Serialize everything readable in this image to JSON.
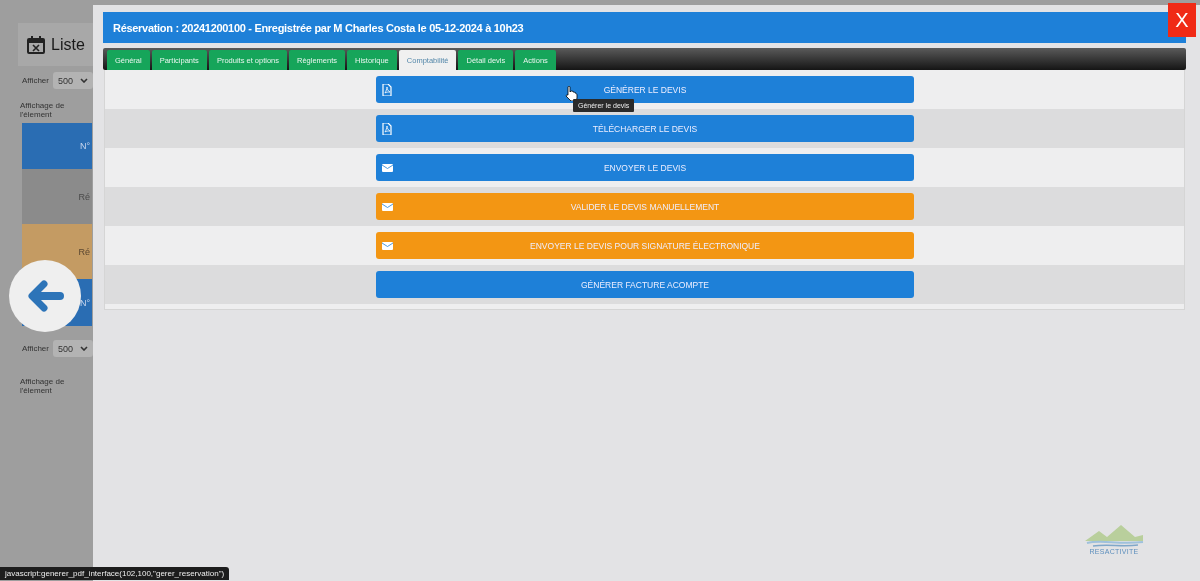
{
  "background_page": {
    "title": "Liste",
    "show_label": "Afficher",
    "show_value": "500",
    "info": "Affichage de l'élement",
    "table_rows": [
      {
        "kind": "header",
        "text": "N°"
      },
      {
        "kind": "gray",
        "text": "Ré"
      },
      {
        "kind": "tan",
        "text": "Ré"
      },
      {
        "kind": "header",
        "text": "N°"
      }
    ],
    "show_label_2": "Afficher",
    "show_value_2": "500",
    "info_2": "Affichage de l'élement"
  },
  "modal": {
    "title": "Réservation : 20241200100 - Enregistrée par M Charles Costa le 05-12-2024 à 10h23",
    "close": "X",
    "tabs": [
      {
        "label": "Général",
        "selected": false
      },
      {
        "label": "Participants",
        "selected": false
      },
      {
        "label": "Produits et options",
        "selected": false
      },
      {
        "label": "Règlements",
        "selected": false
      },
      {
        "label": "Historique",
        "selected": false
      },
      {
        "label": "Comptabilité",
        "selected": true
      },
      {
        "label": "Détail devis",
        "selected": false
      },
      {
        "label": "Actions",
        "selected": false
      }
    ],
    "actions": [
      {
        "label": "GÉNÉRER LE DEVIS",
        "kind": "pdf",
        "color": "#1e80d8"
      },
      {
        "label": "TÉLÉCHARGER LE DEVIS",
        "kind": "pdf",
        "color": "#1e80d8"
      },
      {
        "label": "ENVOYER LE DEVIS",
        "kind": "mail",
        "color": "#1e80d8"
      },
      {
        "label": "VALIDER LE DEVIS MANUELLEMENT",
        "kind": "mail",
        "color": "#f39613"
      },
      {
        "label": "ENVOYER LE DEVIS POUR SIGNATURE ÉLECTRONIQUE",
        "kind": "mail",
        "color": "#f39613"
      },
      {
        "label": "GÉNÉRER FACTURE ACOMPTE",
        "kind": "none",
        "color": "#1e80d8"
      }
    ],
    "tooltip": "Générer le devis"
  },
  "logo": "RESACTIVITE",
  "status_bar": "javascript:generer_pdf_interface(102,100,\"gerer_reservation\")"
}
